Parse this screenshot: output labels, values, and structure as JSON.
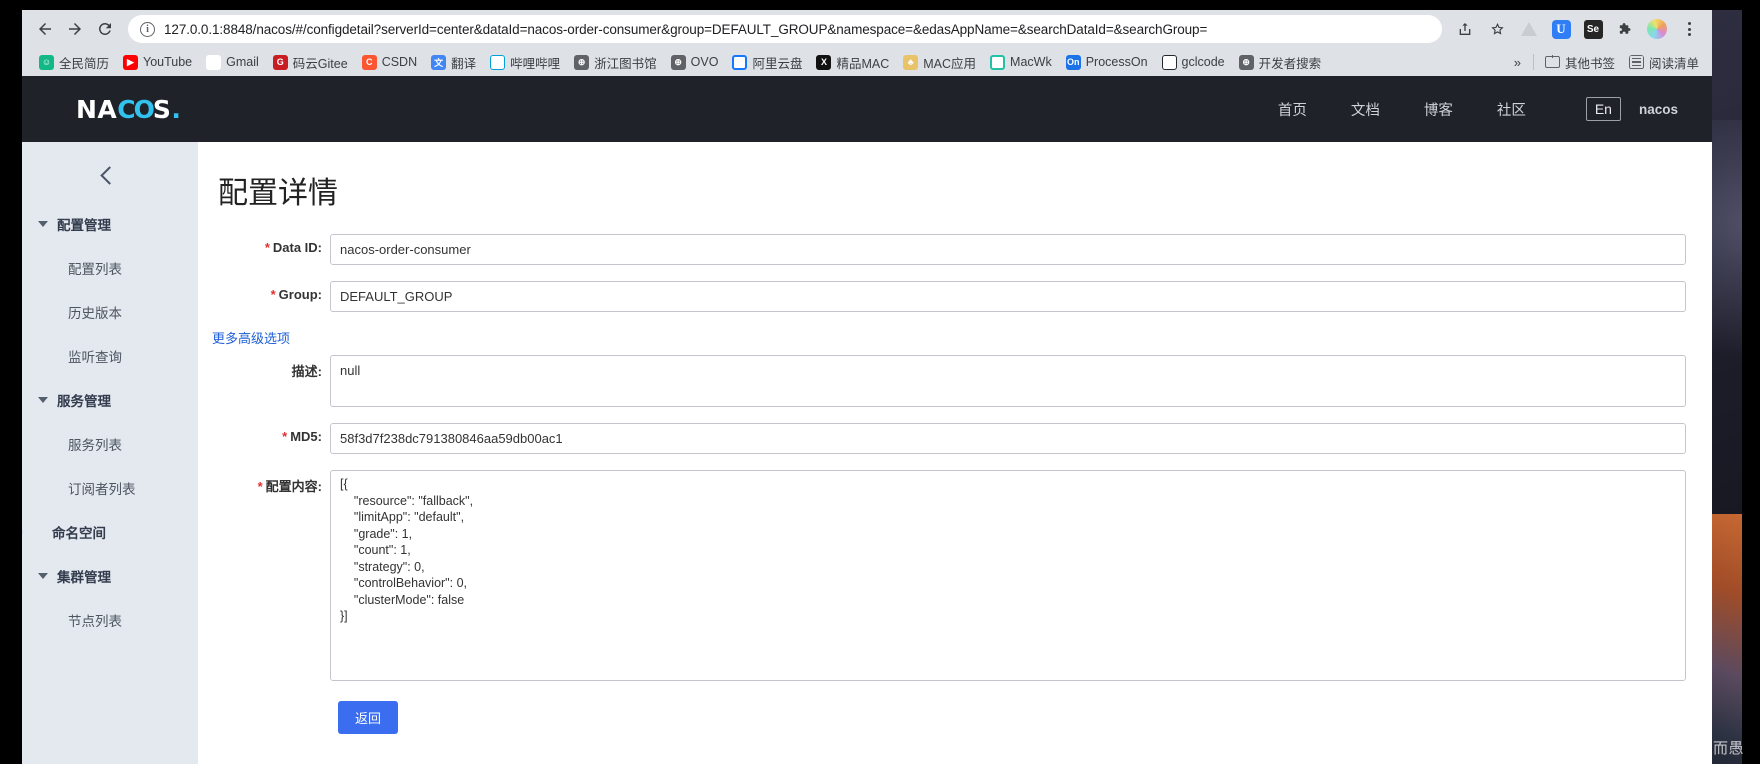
{
  "browser": {
    "back_label": "Back",
    "forward_label": "Forward",
    "reload_label": "Reload",
    "url": "127.0.0.1:8848/nacos/#/configdetail?serverId=center&dataId=nacos-order-consumer&group=DEFAULT_GROUP&namespace=&edasAppName=&searchDataId=&searchGroup=",
    "toolbar_icons": [
      {
        "name": "share-icon",
        "glyph": "⤴"
      },
      {
        "name": "bookmark-star-icon",
        "glyph": "☆"
      },
      {
        "name": "extension-adguard-icon",
        "glyph": ""
      },
      {
        "name": "extension-u-icon",
        "glyph": "U"
      },
      {
        "name": "extension-selenium-icon",
        "glyph": "Se"
      },
      {
        "name": "extensions-puzzle-icon",
        "glyph": "❖"
      },
      {
        "name": "extension-rainbow-icon",
        "glyph": ""
      },
      {
        "name": "chrome-menu-icon",
        "glyph": "⋮"
      }
    ],
    "bookmarks": [
      {
        "label": "全民简历",
        "fav": "f-green",
        "glyph": "☺"
      },
      {
        "label": "YouTube",
        "fav": "f-yt",
        "glyph": "▶"
      },
      {
        "label": "Gmail",
        "fav": "f-gmail",
        "glyph": "M"
      },
      {
        "label": "码云Gitee",
        "fav": "f-gitee",
        "glyph": "G"
      },
      {
        "label": "CSDN",
        "fav": "f-csdn",
        "glyph": "C"
      },
      {
        "label": "翻译",
        "fav": "f-trans",
        "glyph": "G"
      },
      {
        "label": "哔哩哔哩",
        "fav": "f-bili",
        "glyph": "□"
      },
      {
        "label": "浙江图书馆",
        "fav": "f-globe",
        "glyph": "⊕"
      },
      {
        "label": "OVO",
        "fav": "f-globe",
        "glyph": "⊕"
      },
      {
        "label": "阿里云盘",
        "fav": "f-ali",
        "glyph": "O"
      },
      {
        "label": "精品MAC",
        "fav": "f-x",
        "glyph": "X"
      },
      {
        "label": "MAC应用",
        "fav": "f-mac",
        "glyph": "♣"
      },
      {
        "label": "MacWk",
        "fav": "f-macwk",
        "glyph": "C"
      },
      {
        "label": "ProcessOn",
        "fav": "f-on",
        "glyph": "On"
      },
      {
        "label": "gclcode",
        "fav": "f-gh",
        "glyph": "○"
      },
      {
        "label": "开发者搜索",
        "fav": "f-globe",
        "glyph": "⊕"
      }
    ],
    "overflow_label": "»",
    "other_bookmarks_label": "其他书签",
    "reading_list_label": "阅读清单"
  },
  "nacos": {
    "logo": {
      "part1": "NA",
      "part2": "CO",
      "part3": "S",
      "dot": "."
    },
    "nav": [
      {
        "label": "首页"
      },
      {
        "label": "文档"
      },
      {
        "label": "博客"
      },
      {
        "label": "社区"
      }
    ],
    "lang_label": "En",
    "user": "nacos"
  },
  "sidebar": {
    "collapse_label": "收起",
    "sections": [
      {
        "label": "配置管理",
        "items": [
          {
            "label": "配置列表"
          },
          {
            "label": "历史版本"
          },
          {
            "label": "监听查询"
          }
        ]
      },
      {
        "label": "服务管理",
        "items": [
          {
            "label": "服务列表"
          },
          {
            "label": "订阅者列表"
          }
        ]
      }
    ],
    "standalone": {
      "label": "命名空间"
    },
    "cluster": {
      "label": "集群管理",
      "items": [
        {
          "label": "节点列表"
        }
      ]
    }
  },
  "main": {
    "title": "配置详情",
    "advanced_link": "更多高级选项",
    "fields": {
      "data_id": {
        "label": "Data ID:",
        "required": true,
        "value": "nacos-order-consumer"
      },
      "group": {
        "label": "Group:",
        "required": true,
        "value": "DEFAULT_GROUP"
      },
      "description": {
        "label": "描述:",
        "required": false,
        "value": "null"
      },
      "md5": {
        "label": "MD5:",
        "required": true,
        "value": "58f3d7f238dc791380846aa59db00ac1"
      },
      "content": {
        "label": "配置内容:",
        "required": true,
        "value": "[{\n    \"resource\": \"fallback\",\n    \"limitApp\": \"default\",\n    \"grade\": 1,\n    \"count\": 1,\n    \"strategy\": 0,\n    \"controlBehavior\": 0,\n    \"clusterMode\": false\n}]"
      }
    },
    "back_button": "返回"
  },
  "watermark": "CSDN @临水而愚",
  "colors": {
    "accent_blue": "#3a6df0",
    "link_blue": "#1f5fd6",
    "nacos_header_bg": "#1f2329",
    "nacos_logo_cyan": "#31c2f0",
    "sidebar_bg": "#e4e8ef",
    "required_red": "#e03131",
    "browser_chrome": "#dee1e6"
  }
}
